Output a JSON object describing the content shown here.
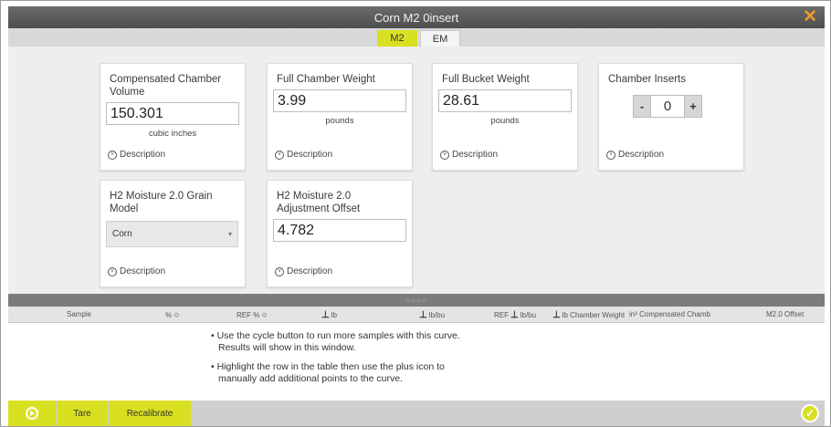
{
  "window": {
    "title": "Corn M2 0insert",
    "close_icon": "close-icon"
  },
  "tabs": [
    {
      "label": "M2",
      "active": true
    },
    {
      "label": "EM",
      "active": false
    }
  ],
  "cards": {
    "compensated_volume": {
      "title": "Compensated Chamber Volume",
      "value": "150.301",
      "unit": "cubic inches",
      "description": "Description"
    },
    "full_chamber_weight": {
      "title": "Full Chamber Weight",
      "value": "3.99",
      "unit": "pounds",
      "description": "Description"
    },
    "full_bucket_weight": {
      "title": "Full Bucket Weight",
      "value": "28.61",
      "unit": "pounds",
      "description": "Description"
    },
    "chamber_inserts": {
      "title": "Chamber Inserts",
      "value": "0",
      "minus": "-",
      "plus": "+",
      "description": "Description"
    },
    "grain_model": {
      "title": "H2 Moisture 2.0 Grain Model",
      "selected": "Corn",
      "description": "Description"
    },
    "adjustment_offset": {
      "title": "H2 Moisture 2.0 Adjustment Offset",
      "value": "4.782",
      "description": "Description"
    }
  },
  "splitter": {
    "dots": "○○○○"
  },
  "table_header": {
    "sample": "Sample",
    "pct": "%",
    "ref_pct": "REF %",
    "lb": "lb",
    "lb_bu": "lb/bu",
    "ref_lb_bu": "REF",
    "ref_lb_bu_unit": "lb/bu",
    "lb_chamber_weight": "lb Chamber Weight",
    "compensated": "in³ Compensated Chamb",
    "m2_offset": "M2.0 Offset"
  },
  "instructions": {
    "line1a": "• Use the cycle button to run more samples with this curve.",
    "line1b": "Results will show in this window.",
    "line2a": "• Highlight the row in the table then use the plus icon to",
    "line2b": "manually add additional points to the curve."
  },
  "bottom_bar": {
    "tare": "Tare",
    "recalibrate": "Recalibrate",
    "confirm": "✓"
  },
  "colors": {
    "accent": "#d9e021",
    "close": "#f19a2d",
    "titlebar": "#5a5a5a"
  }
}
